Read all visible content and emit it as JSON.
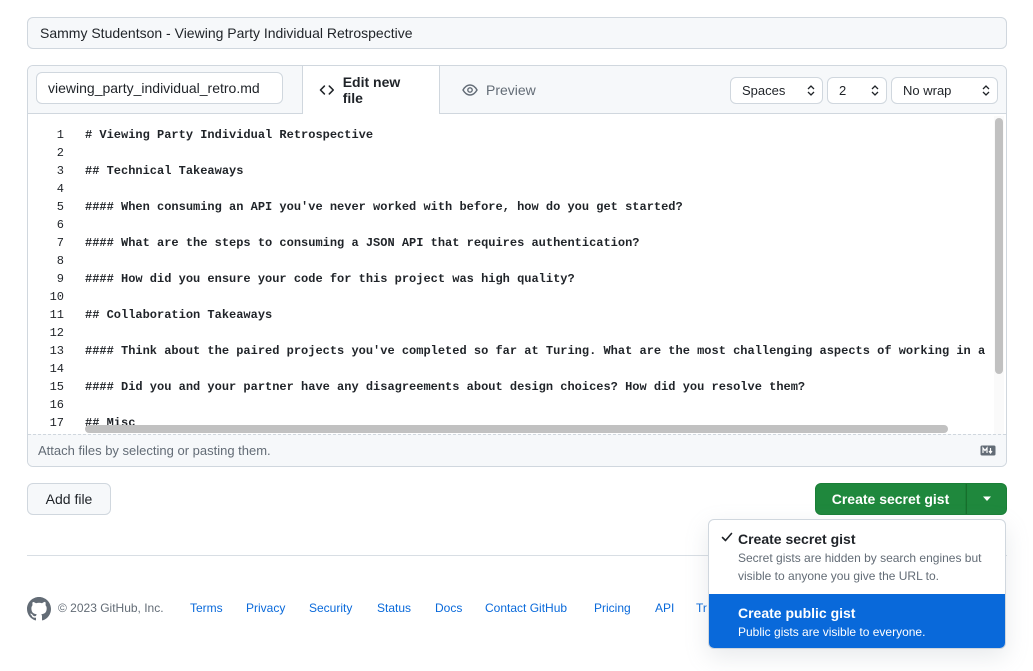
{
  "description": "Sammy Studentson - Viewing Party Individual Retrospective",
  "filename": "viewing_party_individual_retro.md",
  "tabs": {
    "edit": "Edit new file",
    "preview": "Preview"
  },
  "selects": {
    "indent_mode": "Spaces",
    "indent_size": "2",
    "wrap_mode": "No wrap"
  },
  "code_lines": [
    {
      "n": "1",
      "text": "# Viewing Party Individual Retrospective"
    },
    {
      "n": "2",
      "text": ""
    },
    {
      "n": "3",
      "text": "## Technical Takeaways"
    },
    {
      "n": "4",
      "text": ""
    },
    {
      "n": "5",
      "text": "#### When consuming an API you've never worked with before, how do you get started?"
    },
    {
      "n": "6",
      "text": ""
    },
    {
      "n": "7",
      "text": "#### What are the steps to consuming a JSON API that requires authentication?"
    },
    {
      "n": "8",
      "text": ""
    },
    {
      "n": "9",
      "text": "#### How did you ensure your code for this project was high quality?"
    },
    {
      "n": "10",
      "text": ""
    },
    {
      "n": "11",
      "text": "## Collaboration Takeaways"
    },
    {
      "n": "12",
      "text": ""
    },
    {
      "n": "13",
      "text": "#### Think about the paired projects you've completed so far at Turing. What are the most challenging aspects of working in a"
    },
    {
      "n": "14",
      "text": ""
    },
    {
      "n": "15",
      "text": "#### Did you and your partner have any disagreements about design choices? How did you resolve them?"
    },
    {
      "n": "16",
      "text": ""
    },
    {
      "n": "17",
      "text": "## Misc"
    }
  ],
  "attach_hint": "Attach files by selecting or pasting them.",
  "buttons": {
    "add_file": "Add file",
    "create": "Create secret gist"
  },
  "menu": {
    "secret_title": "Create secret gist",
    "secret_desc": "Secret gists are hidden by search engines but visible to anyone you give the URL to.",
    "public_title": "Create public gist",
    "public_desc": "Public gists are visible to everyone."
  },
  "footer": {
    "copyright": "© 2023 GitHub, Inc.",
    "links": [
      "Terms",
      "Privacy",
      "Security",
      "Status",
      "Docs",
      "Contact GitHub",
      "Pricing",
      "API",
      "Tr"
    ]
  },
  "colors": {
    "primary_green": "#1f883d",
    "menu_highlight": "#0969da",
    "link": "#0969da"
  }
}
